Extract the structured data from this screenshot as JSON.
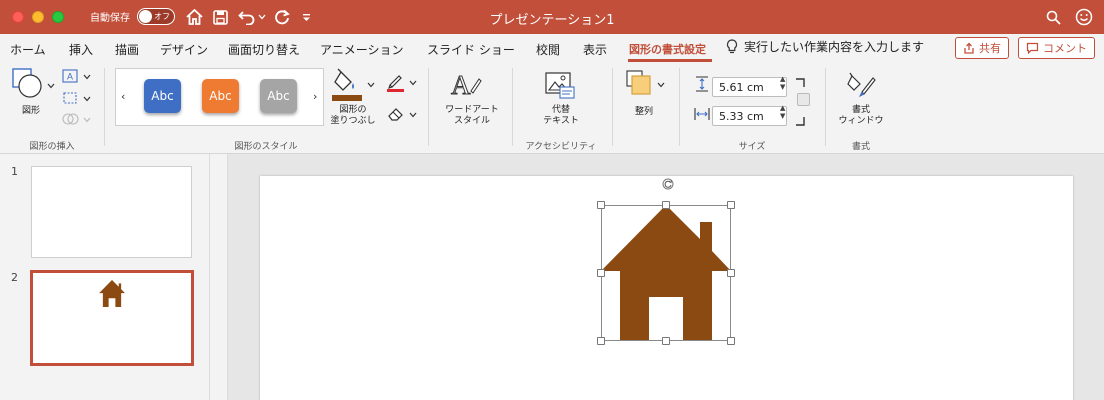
{
  "window": {
    "title": "プレゼンテーション1",
    "autosave_label": "自動保存",
    "autosave_state": "オフ"
  },
  "tabs": [
    {
      "label": "ホーム"
    },
    {
      "label": "挿入"
    },
    {
      "label": "描画"
    },
    {
      "label": "デザイン"
    },
    {
      "label": "画面切り替え"
    },
    {
      "label": "アニメーション"
    },
    {
      "label": "スライド ショー"
    },
    {
      "label": "校閲"
    },
    {
      "label": "表示"
    },
    {
      "label": "図形の書式設定",
      "active": true
    }
  ],
  "tell_me": "実行したい作業内容を入力します",
  "share_label": "共有",
  "comment_label": "コメント",
  "ribbon": {
    "insert_shapes": {
      "shape_label": "図形",
      "group_label": "図形の挿入"
    },
    "shape_styles": {
      "samples": [
        {
          "label": "Abc",
          "color": "#3f6fc4"
        },
        {
          "label": "Abc",
          "color": "#ef7a31"
        },
        {
          "label": "Abc",
          "color": "#a5a5a5"
        }
      ],
      "fill_label": "図形の\n塗りつぶし",
      "group_label": "図形のスタイル",
      "fill_color": "#8b4a12",
      "line_color": "#e0262e"
    },
    "wordart": {
      "label": "ワードアート\nスタイル"
    },
    "accessibility": {
      "alt_text_label": "代替\nテキスト",
      "group_label": "アクセシビリティ"
    },
    "arrange": {
      "label": "整列"
    },
    "size": {
      "height": "5.61 cm",
      "width": "5.33 cm",
      "group_label": "サイズ"
    },
    "format": {
      "pane_label": "書式\nウィンドウ",
      "group_label": "書式"
    }
  },
  "slides": [
    {
      "number": "1"
    },
    {
      "number": "2",
      "selected": true
    }
  ],
  "colors": {
    "accent": "#c14f3a",
    "house": "#8b4a12"
  }
}
